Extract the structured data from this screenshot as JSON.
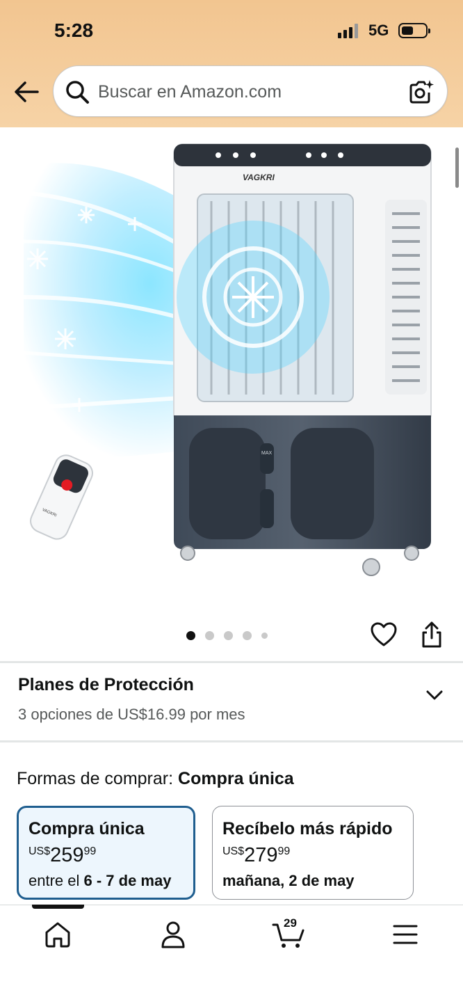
{
  "status_bar": {
    "time": "5:28",
    "network": "5G"
  },
  "search": {
    "placeholder": "Buscar en Amazon.com"
  },
  "product_image": {
    "brand_text": "VAGKRI",
    "label": "MAX",
    "slide_count": 5,
    "active_slide": 1
  },
  "protection_plans": {
    "title": "Planes de Protección",
    "subtitle": "3 opciones de US$16.99 por mes"
  },
  "ways_to_buy": {
    "label": "Formas de comprar:",
    "selected": "Compra única",
    "options": [
      {
        "title": "Compra única",
        "currency": "US$",
        "price_whole": "259",
        "price_fraction": "99",
        "delivery_prefix": "entre el ",
        "delivery_date": "6 - 7 de may"
      },
      {
        "title": "Recíbelo más rápido",
        "currency": "US$",
        "price_whole": "279",
        "price_fraction": "99",
        "delivery_prefix": "",
        "delivery_date": "mañana, 2 de may"
      }
    ]
  },
  "bottom_nav": {
    "cart_count": "29"
  },
  "colors": {
    "header": "#f2c590",
    "selected_border": "#1f5e8f",
    "selected_bg": "#edf6fd"
  }
}
